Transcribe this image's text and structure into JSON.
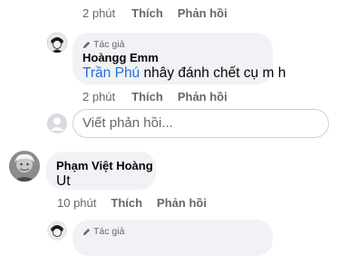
{
  "thread": {
    "top_actions": {
      "time": "2 phút",
      "like": "Thích",
      "reply": "Phản hồi"
    },
    "reply1": {
      "badge": "Tác giả",
      "author": "Hoàngg Emm",
      "mention": "Trần Phú",
      "text": " nhây đánh chết cụ m h",
      "actions": {
        "time": "2 phút",
        "like": "Thích",
        "reply": "Phản hồi"
      }
    },
    "reply_input": {
      "placeholder": "Viết phản hồi..."
    },
    "comment2": {
      "author": "Phạm Việt Hoàng",
      "text": "Ut",
      "actions": {
        "time": "10 phút",
        "like": "Thích",
        "reply": "Phản hồi"
      }
    },
    "reply2": {
      "badge": "Tác giả"
    }
  },
  "colors": {
    "bubble": "#f0f2f5",
    "mention": "#216fdb",
    "meta": "#65676b"
  }
}
